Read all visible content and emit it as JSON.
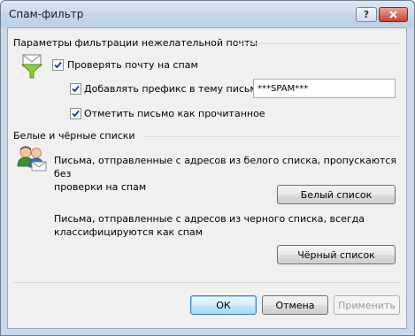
{
  "window": {
    "title": "Спам-фильтр"
  },
  "filter_section": {
    "title": "Параметры фильтрации нежелательной почты",
    "check_spam": {
      "label": "Проверять почту на спам",
      "checked": true
    },
    "add_prefix": {
      "label": "Добавлять префикс в тему письма",
      "checked": true,
      "value": "***SPAM***"
    },
    "mark_read": {
      "label": "Отметить письмо как прочитанное",
      "checked": true
    }
  },
  "lists_section": {
    "title": "Белые и чёрные списки",
    "white_desc_line1": "Письма, отправленные с адресов из белого списка, пропускаются без",
    "white_desc_line2": "проверки на спам",
    "white_button": "Белый список",
    "black_desc_line1": "Письма, отправленные с адресов из черного списка, всегда",
    "black_desc_line2": "классифицируются как спам",
    "black_button": "Чёрный список"
  },
  "footer": {
    "ok": "ОК",
    "cancel": "Отмена",
    "apply": "Применить"
  },
  "icons": {
    "filter": "funnel-envelope-icon",
    "users": "users-envelope-icon"
  },
  "colors": {
    "accent": "#3c7fb1",
    "check": "#1a3b8c"
  }
}
